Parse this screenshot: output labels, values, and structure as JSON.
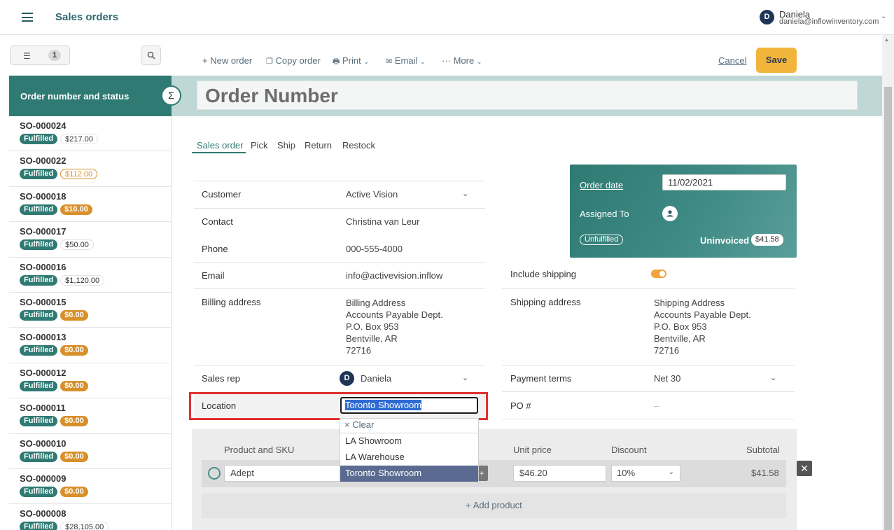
{
  "app": {
    "title": "Sales orders"
  },
  "user": {
    "initial": "D",
    "name": "Daniela",
    "email": "daniela@inflowinventory.com"
  },
  "filter": {
    "count": "1"
  },
  "list": {
    "header": "Order number and status",
    "orders": [
      {
        "number": "SO-000024",
        "status": "Fulfilled",
        "amount": "$217.00",
        "amount_style": "white"
      },
      {
        "number": "SO-000022",
        "status": "Fulfilled",
        "amount": "$112.00",
        "amount_style": "outline"
      },
      {
        "number": "SO-000018",
        "status": "Fulfilled",
        "amount": "$10.00",
        "amount_style": "orange"
      },
      {
        "number": "SO-000017",
        "status": "Fulfilled",
        "amount": "$50.00",
        "amount_style": "white"
      },
      {
        "number": "SO-000016",
        "status": "Fulfilled",
        "amount": "$1,120.00",
        "amount_style": "white"
      },
      {
        "number": "SO-000015",
        "status": "Fulfilled",
        "amount": "$0.00",
        "amount_style": "orange"
      },
      {
        "number": "SO-000013",
        "status": "Fulfilled",
        "amount": "$0.00",
        "amount_style": "orange"
      },
      {
        "number": "SO-000012",
        "status": "Fulfilled",
        "amount": "$0.00",
        "amount_style": "orange"
      },
      {
        "number": "SO-000011",
        "status": "Fulfilled",
        "amount": "$0.00",
        "amount_style": "orange"
      },
      {
        "number": "SO-000010",
        "status": "Fulfilled",
        "amount": "$0.00",
        "amount_style": "orange"
      },
      {
        "number": "SO-000009",
        "status": "Fulfilled",
        "amount": "$0.00",
        "amount_style": "orange"
      },
      {
        "number": "SO-000008",
        "status": "Fulfilled",
        "amount": "$28,105.00",
        "amount_style": "white"
      }
    ]
  },
  "toolbar": {
    "new_order": "+ New order",
    "copy_order": "Copy order",
    "print": "Print",
    "email": "Email",
    "more": "··· More",
    "cancel": "Cancel",
    "save": "Save"
  },
  "order": {
    "title_placeholder": "Order Number"
  },
  "tabs": [
    "Sales order",
    "Pick",
    "Ship",
    "Return",
    "Restock"
  ],
  "form": {
    "customer": {
      "label": "Customer",
      "value": "Active Vision"
    },
    "contact": {
      "label": "Contact",
      "value": "Christina van Leur"
    },
    "phone": {
      "label": "Phone",
      "value": "000-555-4000"
    },
    "email": {
      "label": "Email",
      "value": "info@activevision.inflow"
    },
    "billing": {
      "label": "Billing address",
      "lines": [
        "Billing Address",
        "Accounts Payable Dept.",
        "P.O. Box 953",
        "Bentville, AR",
        "72716"
      ]
    },
    "sales_rep": {
      "label": "Sales rep",
      "initial": "D",
      "value": "Daniela"
    },
    "location": {
      "label": "Location",
      "value": "Toronto Showroom"
    },
    "include_shipping": {
      "label": "Include shipping"
    },
    "shipping": {
      "label": "Shipping address",
      "lines": [
        "Shipping Address",
        "Accounts Payable Dept.",
        "P.O. Box 953",
        "Bentville, AR",
        "72716"
      ]
    },
    "payment_terms": {
      "label": "Payment terms",
      "value": "Net 30"
    },
    "po": {
      "label": "PO #",
      "value": "–"
    }
  },
  "location_dropdown": {
    "clear": "Clear",
    "options": [
      "LA Showroom",
      "LA Warehouse",
      "Toronto Showroom"
    ],
    "selected": "Toronto Showroom"
  },
  "info_card": {
    "order_date_label": "Order date",
    "order_date": "11/02/2021",
    "assigned_to_label": "Assigned To",
    "status": "Unfulfilled",
    "invoice_status": "Uninvoiced",
    "amount": "$41.58"
  },
  "products": {
    "headers": {
      "product": "Product and SKU",
      "unit_price": "Unit price",
      "discount": "Discount",
      "subtotal": "Subtotal"
    },
    "rows": [
      {
        "product": "Adept",
        "unit_price": "$46.20",
        "discount": "10%",
        "subtotal": "$41.58"
      }
    ],
    "add_label": "+ Add product"
  },
  "colors": {
    "brand": "#2f7a73",
    "accent": "#f2b53c",
    "highlight": "#e03131"
  }
}
